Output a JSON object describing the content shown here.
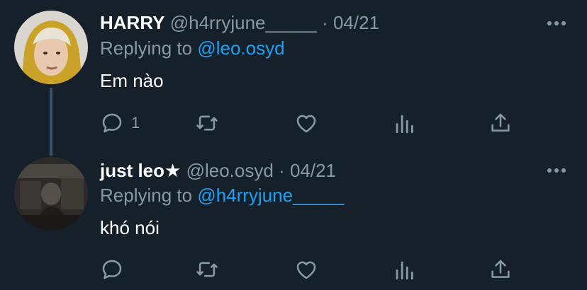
{
  "tweets": [
    {
      "name": "HARRY",
      "handle": "@h4rryjune_____",
      "separator": "·",
      "date": "04/21",
      "replying_prefix": "Replying to",
      "replying_to": "@leo.osyd",
      "text": "Em nào",
      "reply_count": "1",
      "avatar_desc": "avatar-photo"
    },
    {
      "name": "just leo",
      "name_badge": "★",
      "handle": "@leo.osyd",
      "separator": "·",
      "date": "04/21",
      "replying_prefix": "Replying to",
      "replying_to": "@h4rryjune_____",
      "text": "khó nói",
      "reply_count": "",
      "avatar_desc": "avatar-photo"
    }
  ],
  "icons": [
    "more-icon",
    "reply-icon",
    "retweet-icon",
    "like-icon",
    "analytics-icon",
    "share-icon"
  ],
  "colors": {
    "background": "#15202b",
    "secondary_text": "#8899a6",
    "accent": "#1da1f2",
    "thread_line": "#3d5466"
  }
}
